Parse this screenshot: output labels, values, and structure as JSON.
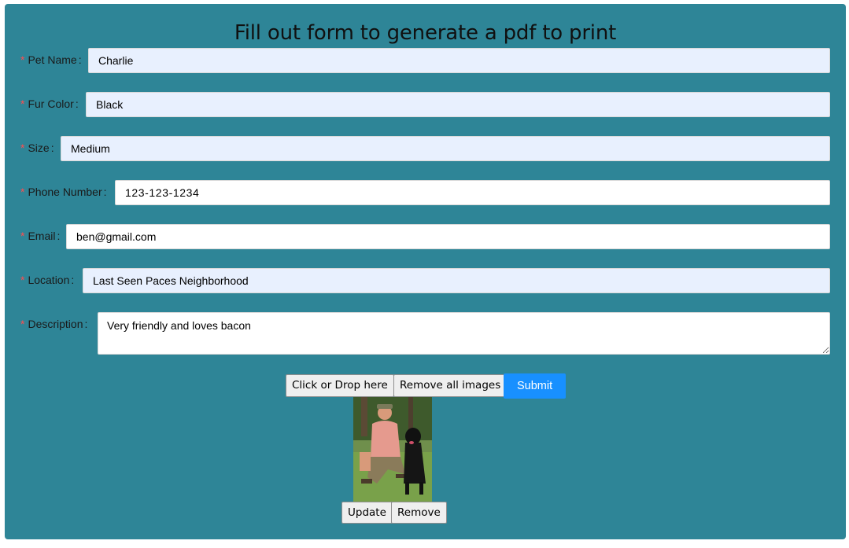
{
  "form": {
    "title": "Fill out form to generate a pdf to print",
    "required_mark": "*",
    "fields": [
      {
        "label": "Pet Name",
        "value": "Charlie"
      },
      {
        "label": "Fur Color",
        "value": "Black"
      },
      {
        "label": "Size",
        "value": "Medium"
      },
      {
        "label": "Phone Number",
        "value": "123-123-1234"
      },
      {
        "label": "Email",
        "value": "ben@gmail.com"
      },
      {
        "label": "Location",
        "value": "Last Seen Paces Neighborhood"
      },
      {
        "label": "Description",
        "value": "Very friendly and loves bacon"
      }
    ],
    "colon": ":"
  },
  "upload": {
    "click_or_drop_label": "Click or Drop here",
    "remove_all_label": "Remove all images",
    "submit_label": "Submit"
  },
  "image_item": {
    "update_label": "Update",
    "remove_label": "Remove"
  },
  "colors": {
    "panel": "#2e8597",
    "autofill": "#e8f0fe",
    "primary": "#1890ff",
    "required": "#ff4d4f"
  }
}
